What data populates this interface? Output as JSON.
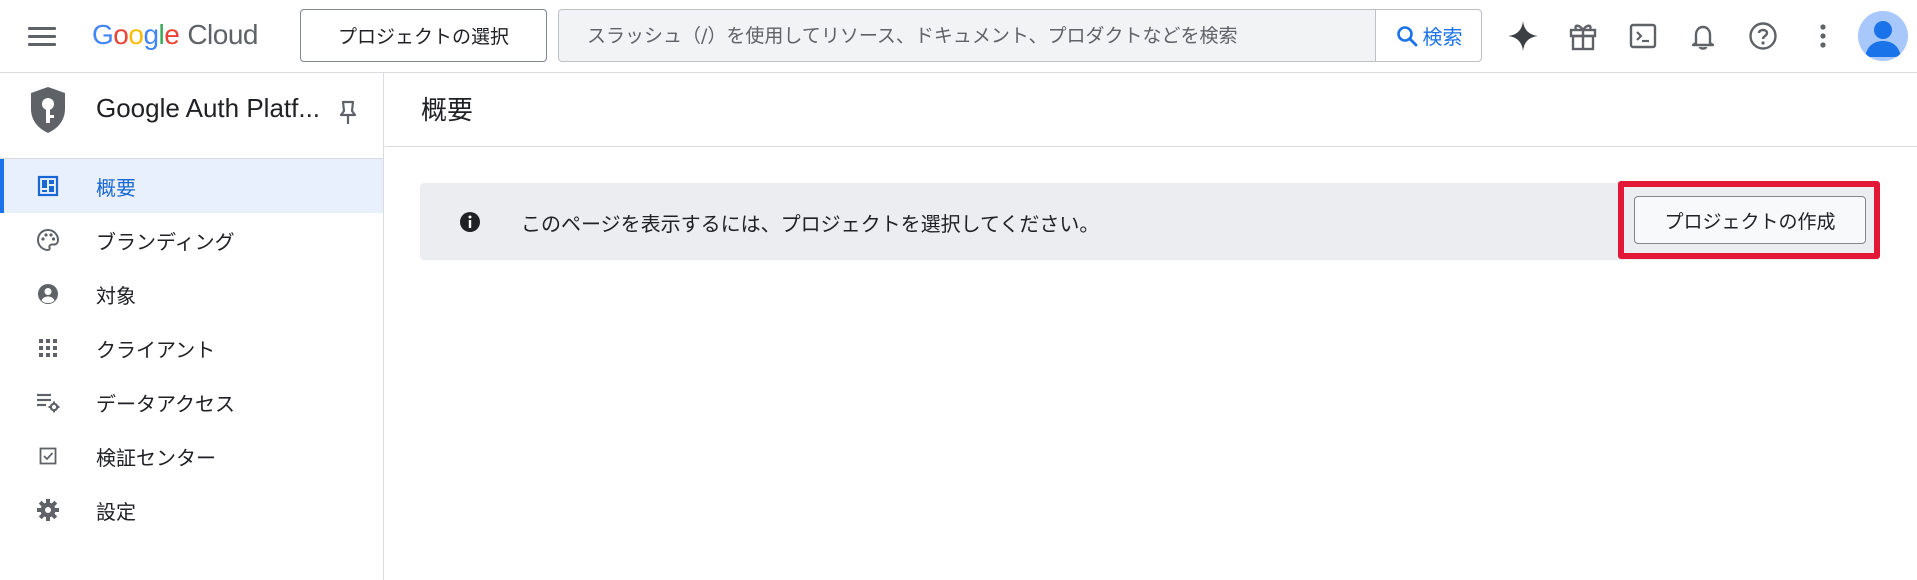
{
  "header": {
    "logo": {
      "g1": "G",
      "o1": "o",
      "o2": "o",
      "g2": "g",
      "l": "l",
      "e": "e",
      "product": "Cloud"
    },
    "project_selector_label": "プロジェクトの選択",
    "search": {
      "placeholder": "スラッシュ（/）を使用してリソース、ドキュメント、プロダクトなどを検索",
      "button_label": "検索"
    },
    "icons": [
      "gemini-icon",
      "gift-icon",
      "cloud-shell-icon",
      "notifications-icon",
      "help-icon",
      "more-vert-icon"
    ]
  },
  "sidebar": {
    "title": "Google Auth Platf...",
    "items": [
      {
        "label": "概要",
        "icon": "dashboard-icon",
        "active": true
      },
      {
        "label": "ブランディング",
        "icon": "palette-icon",
        "active": false
      },
      {
        "label": "対象",
        "icon": "account-circle-icon",
        "active": false
      },
      {
        "label": "クライアント",
        "icon": "apps-grid-icon",
        "active": false
      },
      {
        "label": "データアクセス",
        "icon": "data-settings-icon",
        "active": false
      },
      {
        "label": "検証センター",
        "icon": "checkbox-icon",
        "active": false
      },
      {
        "label": "設定",
        "icon": "gear-icon",
        "active": false
      }
    ]
  },
  "main": {
    "title": "概要",
    "banner": {
      "message": "このページを表示するには、プロジェクトを選択してください。",
      "action_label": "プロジェクトの作成"
    }
  },
  "colors": {
    "accent": "#1a73e8",
    "active_bg": "#e8f0fe",
    "banner_bg": "#ebedf0",
    "highlight": "#e31837"
  }
}
